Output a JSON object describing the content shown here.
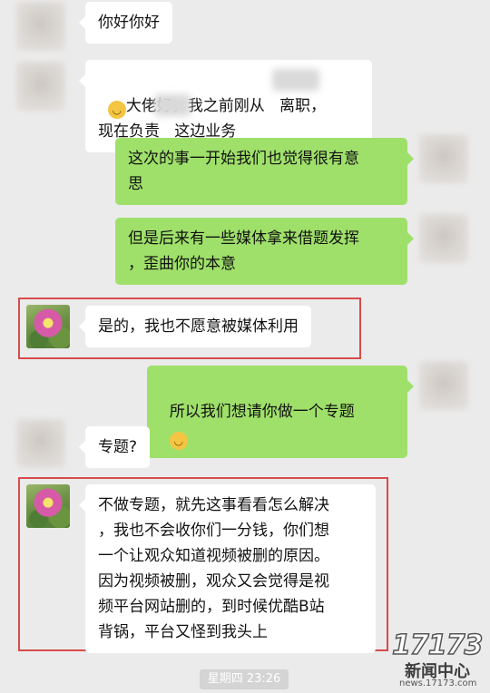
{
  "messages": [
    {
      "side": "left",
      "text": "你好你好"
    },
    {
      "side": "left",
      "emoji": "😊",
      "text": "大佬好，我之前刚从   离职，\n现在负责   这边业务"
    },
    {
      "side": "right",
      "text": "这次的事一开始我们也觉得很有意\n思"
    },
    {
      "side": "right",
      "text": "但是后来有一些媒体拿来借题发挥\n，歪曲你的本意"
    },
    {
      "side": "left",
      "text": "是的，我也不愿意被媒体利用"
    },
    {
      "side": "right",
      "text": "所以我们想请你做一个专题",
      "emoji": "😁"
    },
    {
      "side": "left",
      "text": "专题?"
    },
    {
      "side": "left",
      "text": "不做专题，就先这事看看怎么解决\n，我也不会收你们一分钱，你们想\n一个让观众知道视频被删的原因。\n因为视频被删，观众又会觉得是视\n频平台网站删的，到时候优酷B站\n背锅，平台又怪到我头上"
    }
  ],
  "timestamp": "星期四 23:26",
  "watermark": {
    "number": "17173",
    "label": "新闻中心",
    "url": "news.17173.com"
  },
  "colors": {
    "background": "#ebebeb",
    "bubble_left": "#ffffff",
    "bubble_right": "#9fe06a",
    "highlight_box": "#d94b4b"
  }
}
